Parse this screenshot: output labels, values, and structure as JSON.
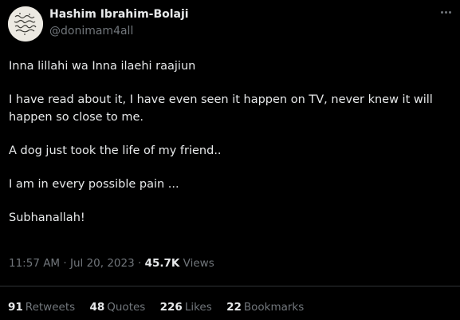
{
  "author": {
    "name": "Hashim Ibrahim-Bolaji",
    "handle": "@donimam4all"
  },
  "tweet": {
    "paragraphs": [
      "Inna lillahi wa Inna ilaehi raajiun",
      "I have read about it, I have even seen it happen on TV, never knew it will happen so close to me.",
      "A dog just took the life of my friend..",
      "I am in every possible pain ...",
      "Subhanallah!"
    ],
    "time": "11:57 AM",
    "date": "Jul 20, 2023",
    "separator": "·",
    "views_count": "45.7K",
    "views_label": "Views"
  },
  "stats": {
    "retweets_count": "91",
    "retweets_label": "Retweets",
    "quotes_count": "48",
    "quotes_label": "Quotes",
    "likes_count": "226",
    "likes_label": "Likes",
    "bookmarks_count": "22",
    "bookmarks_label": "Bookmarks"
  },
  "icons": {
    "more": "more-options-icon"
  },
  "colors": {
    "background": "#000000",
    "primary_text": "#e7e9ea",
    "secondary_text": "#71767b",
    "divider": "#2f3336"
  }
}
